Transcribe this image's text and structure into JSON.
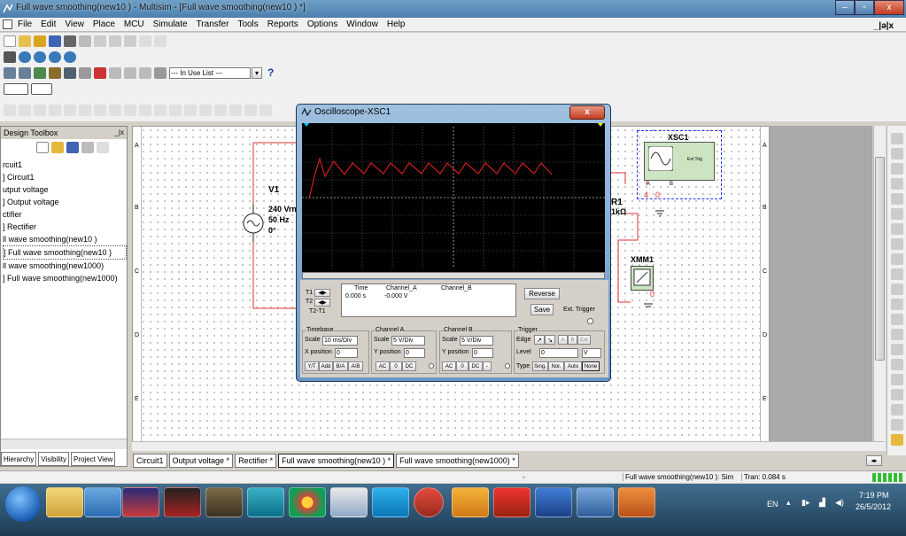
{
  "window": {
    "title": "Full wave smoothing(new10 ) - Multisim - [Full wave smoothing(new10 ) *]",
    "controls": [
      "–",
      "▫",
      "x"
    ],
    "inner_controls": "_|ə|x"
  },
  "menu": [
    "File",
    "Edit",
    "View",
    "Place",
    "MCU",
    "Simulate",
    "Transfer",
    "Tools",
    "Reports",
    "Options",
    "Window",
    "Help"
  ],
  "toolbar": {
    "in_use_list": "--- In Use List ---",
    "help": "?"
  },
  "toolbox": {
    "title": "Design Toolbox",
    "close": "_|x",
    "items": [
      "rcuit1",
      "] Circuit1",
      "utput voltage",
      "] Output voltage",
      "ctifier",
      "] Rectifier",
      "ll wave smoothing(new10 )",
      "] Full wave smoothing(new10 )",
      "ll wave smoothing(new1000)",
      "] Full wave smoothing(new1000)"
    ],
    "tabs": [
      "Hierarchy",
      "Visibility",
      "Project View"
    ]
  },
  "rulers": {
    "rows": [
      "A",
      "B",
      "C",
      "D",
      "E"
    ]
  },
  "schematic": {
    "v1_name": "V1",
    "v1_voltage": "240 Vrm",
    "v1_freq": "50 Hz",
    "v1_phase": "0°",
    "r1_name": "R1",
    "r1_value": "1kΩ",
    "xsc_name": "XSC1",
    "xsc_label": "Ext Trig",
    "xmm_name": "XMM1",
    "node_a": "A",
    "node_b": "B",
    "wire_4": "4",
    "wire_0": "0"
  },
  "oscilloscope": {
    "title": "Oscilloscope-XSC1",
    "close": "x",
    "readout": {
      "t1": "T1",
      "t2": "T2",
      "t2t1": "T2-T1",
      "time_hdr": "Time",
      "cha_hdr": "Channel_A",
      "chb_hdr": "Channel_B",
      "time_val": "0.000 s",
      "cha_val": "-0.000 V"
    },
    "buttons": {
      "reverse": "Reverse",
      "save": "Save",
      "ext_trigger": "Ext. Trigger"
    },
    "timebase": {
      "title": "Timebase",
      "scale_label": "Scale",
      "scale": "10 ms/Div",
      "xpos_label": "X position",
      "xpos": "0",
      "modes": [
        "Y/T",
        "Add",
        "B/A",
        "A/B"
      ]
    },
    "channel_a": {
      "title": "Channel A",
      "scale_label": "Scale",
      "scale": "5  V/Div",
      "ypos_label": "Y position",
      "ypos": "0",
      "coupling": [
        "AC",
        "0",
        "DC"
      ]
    },
    "channel_b": {
      "title": "Channel B",
      "scale_label": "Scale",
      "scale": "5  V/Div",
      "ypos_label": "Y position",
      "ypos": "0",
      "coupling": [
        "AC",
        "0",
        "DC",
        "-"
      ]
    },
    "trigger": {
      "title": "Trigger",
      "edge_label": "Edge",
      "edge_buttons": [
        "A",
        "B",
        "Ext"
      ],
      "level_label": "Level",
      "level": "0",
      "level_unit": "V",
      "type_label": "Type",
      "types": [
        "Sing.",
        "Nor.",
        "Auto",
        "None"
      ]
    }
  },
  "tabs": [
    "Circuit1",
    "Output voltage *",
    "Rectifier *",
    "Full wave smoothing(new10 ) *",
    "Full wave smoothing(new1000) *"
  ],
  "statusbar": {
    "dash": "-",
    "file": "Full wave smoothing(new10 ): Sim",
    "tran": "Tran: 0.084 s"
  },
  "taskbar": {
    "lang": "EN",
    "time": "7:19 PM",
    "date": "26/5/2012"
  },
  "colors": {
    "wire": "#e03030",
    "trace": "#e02020",
    "titlebar": "#4c7fb0",
    "screen": "#000000"
  }
}
